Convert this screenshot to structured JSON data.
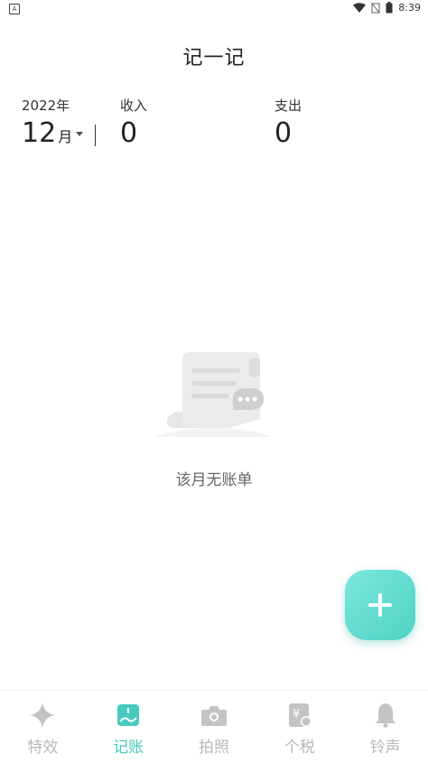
{
  "status": {
    "time": "8:39"
  },
  "header": {
    "title": "记一记"
  },
  "summary": {
    "year": "2022年",
    "month": "12",
    "month_unit": "月",
    "income_label": "收入",
    "income_value": "0",
    "expense_label": "支出",
    "expense_value": "0"
  },
  "empty": {
    "text": "该月无账单"
  },
  "fab": {
    "icon": "plus-icon"
  },
  "nav": {
    "items": [
      {
        "label": "特效",
        "icon": "sparkle-icon",
        "active": false
      },
      {
        "label": "记账",
        "icon": "ledger-icon",
        "active": true
      },
      {
        "label": "拍照",
        "icon": "camera-icon",
        "active": false
      },
      {
        "label": "个税",
        "icon": "tax-icon",
        "active": false
      },
      {
        "label": "铃声",
        "icon": "bell-icon",
        "active": false
      }
    ]
  },
  "colors": {
    "accent": "#46cbbd",
    "inactive": "#b8b8b8",
    "fab_start": "#7be8df",
    "fab_end": "#4fd1c3"
  }
}
